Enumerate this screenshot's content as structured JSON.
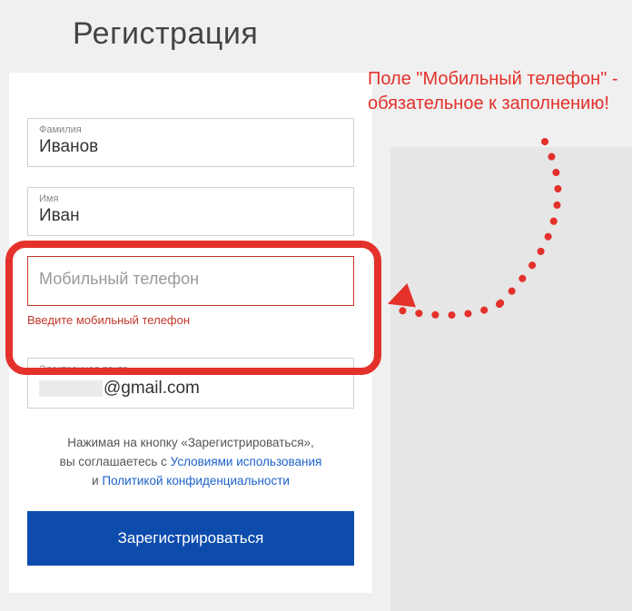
{
  "title": "Регистрация",
  "annotation": "Поле \"Мобильный телефон\" - обязательное к заполнению!",
  "fields": {
    "lastname": {
      "label": "Фамилия",
      "value": "Иванов"
    },
    "firstname": {
      "label": "Имя",
      "value": "Иван"
    },
    "phone": {
      "placeholder": "Мобильный телефон",
      "error": "Введите мобильный телефон"
    },
    "email": {
      "label": "Электронная почта",
      "value_suffix": "@gmail.com"
    }
  },
  "terms": {
    "line1a": "Нажимая на кнопку «Зарегистрироваться»,",
    "line2a": "вы соглашаетесь с ",
    "terms_link": "Условиями использования",
    "line3a": "и ",
    "privacy_link": "Политикой конфиденциальности"
  },
  "submit": "Зарегистрироваться"
}
